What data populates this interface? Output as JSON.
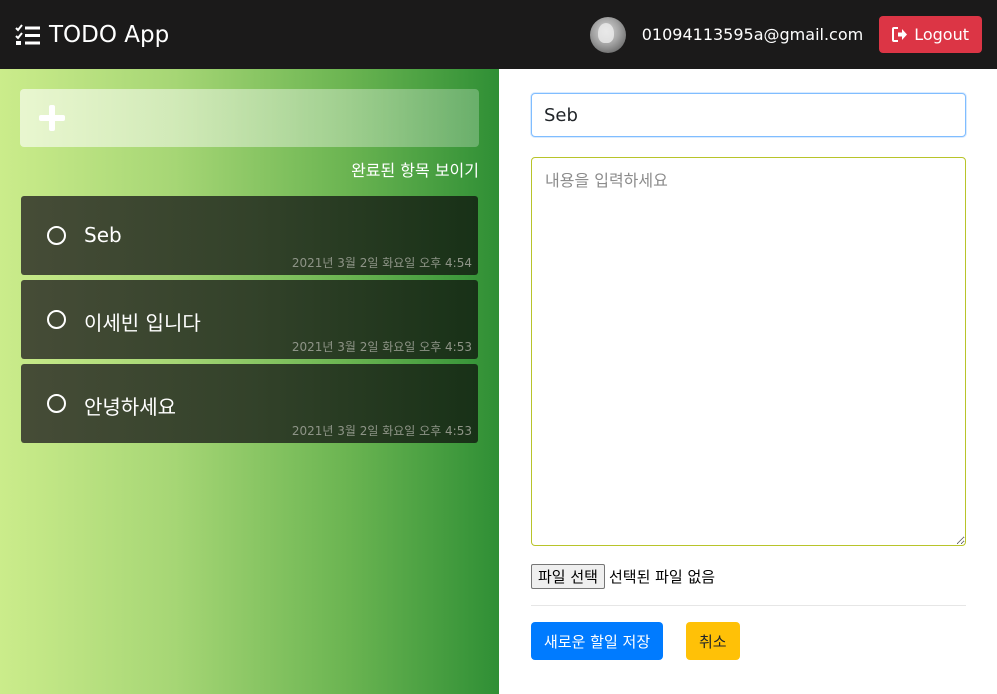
{
  "navbar": {
    "brand_icon": "task-list-icon",
    "brand": "TODO App",
    "user_email": "01094113595a@gmail.com",
    "logout_icon": "sign-out-icon",
    "logout_label": "Logout"
  },
  "sidebar": {
    "add_icon": "plus-icon",
    "show_completed_label": "완료된 항목 보이기",
    "todos": [
      {
        "title": "Seb",
        "date": "2021년 3월 2일 화요일 오후 4:54"
      },
      {
        "title": "이세빈 입니다",
        "date": "2021년 3월 2일 화요일 오후 4:53"
      },
      {
        "title": "안녕하세요",
        "date": "2021년 3월 2일 화요일 오후 4:53"
      }
    ]
  },
  "editor": {
    "title_value": "Seb",
    "content_placeholder": "내용을 입력하세요",
    "file_button_label": "파일 선택",
    "file_status": "선택된 파일 없음",
    "save_label": "새로운 할일 저장",
    "cancel_label": "취소"
  },
  "colors": {
    "navbar_bg": "#1b1a1a",
    "logout": "#dc3545",
    "save": "#007bff",
    "cancel": "#ffc107"
  }
}
